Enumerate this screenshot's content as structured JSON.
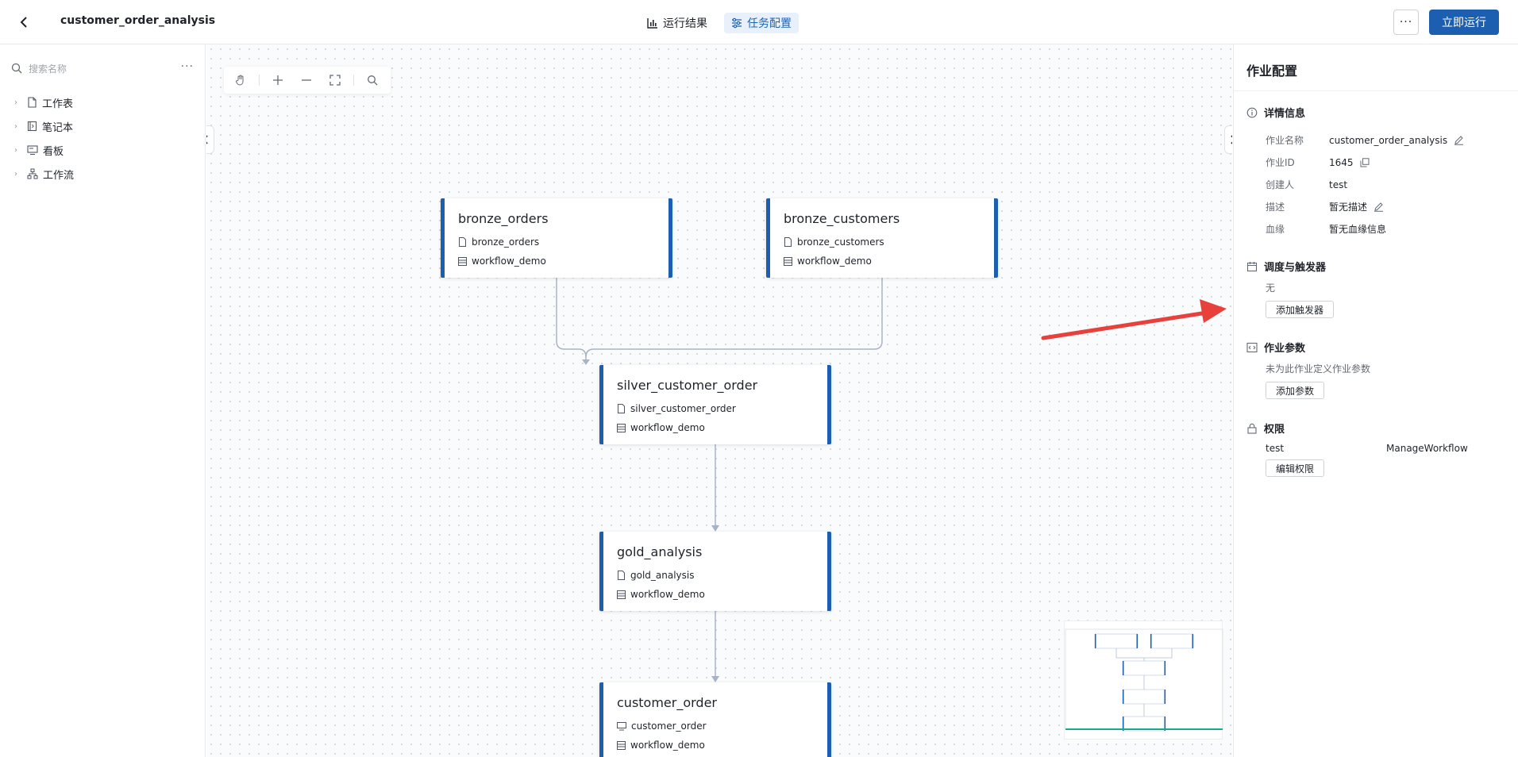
{
  "header": {
    "job_title": "customer_order_analysis",
    "tabs": [
      {
        "label": "运行结果",
        "icon": "bar-chart-icon"
      },
      {
        "label": "任务配置",
        "icon": "sliders-icon"
      }
    ],
    "more_label": "···",
    "run_label": "立即运行"
  },
  "sidebar": {
    "search_placeholder": "搜索名称",
    "more_label": "···",
    "items": [
      {
        "label": "工作表",
        "icon": "file-icon"
      },
      {
        "label": "笔记本",
        "icon": "notebook-icon"
      },
      {
        "label": "看板",
        "icon": "dashboard-icon"
      },
      {
        "label": "工作流",
        "icon": "workflow-icon"
      }
    ]
  },
  "nodes": [
    {
      "title": "bronze_orders",
      "file": "bronze_orders",
      "schema": "workflow_demo"
    },
    {
      "title": "bronze_customers",
      "file": "bronze_customers",
      "schema": "workflow_demo"
    },
    {
      "title": "silver_customer_order",
      "file": "silver_customer_order",
      "schema": "workflow_demo"
    },
    {
      "title": "gold_analysis",
      "file": "gold_analysis",
      "schema": "workflow_demo"
    },
    {
      "title": "customer_order",
      "file": "customer_order",
      "schema": "workflow_demo"
    }
  ],
  "panel": {
    "title": "作业配置",
    "details": {
      "heading": "详情信息",
      "rows": [
        {
          "key": "作业名称",
          "value": "customer_order_analysis"
        },
        {
          "key": "作业ID",
          "value": "1645"
        },
        {
          "key": "创建人",
          "value": "test"
        },
        {
          "key": "描述",
          "value": "暂无描述"
        },
        {
          "key": "血缘",
          "value": "暂无血缘信息"
        }
      ]
    },
    "schedule": {
      "heading": "调度与触发器",
      "empty_text": "无",
      "add_button": "添加触发器"
    },
    "params": {
      "heading": "作业参数",
      "empty_text": "未为此作业定义作业参数",
      "add_button": "添加参数"
    },
    "permissions": {
      "heading": "权限",
      "user": "test",
      "permission": "ManageWorkflow",
      "edit_button": "编辑权限"
    }
  },
  "colors": {
    "accent": "#1c5fb0",
    "annotation_arrow": "#e8403a",
    "edge": "#a7b4c6"
  }
}
